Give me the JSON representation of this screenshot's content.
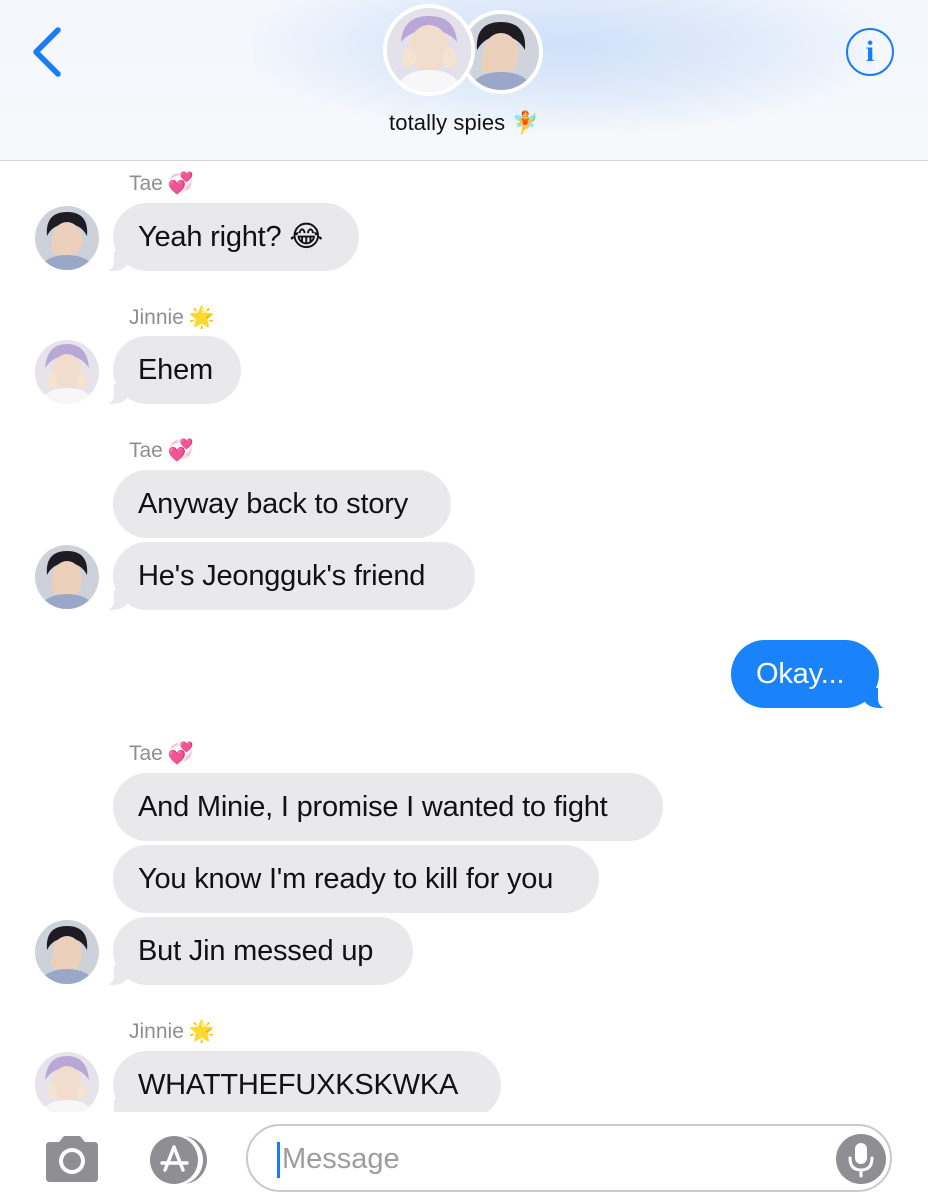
{
  "header": {
    "title": "totally spies",
    "title_emoji": "🧚"
  },
  "messages": [
    {
      "sender": "Tae",
      "emoji": "💞",
      "texts": [
        "Yeah right? 😂"
      ]
    },
    {
      "sender": "Jinnie",
      "emoji": "🌟",
      "texts": [
        "Ehem"
      ]
    },
    {
      "sender": "Tae",
      "emoji": "💞",
      "texts": [
        "Anyway back to story",
        "He's Jeongguk's friend"
      ]
    },
    {
      "outgoing": true,
      "texts": [
        "Okay..."
      ]
    },
    {
      "sender": "Tae",
      "emoji": "💞",
      "texts": [
        "And Minie, I promise I wanted to fight",
        "You know I'm ready to kill for you",
        "But Jin messed up"
      ]
    },
    {
      "sender": "Jinnie",
      "emoji": "🌟",
      "texts": [
        "WHATTHEFUXKSKWKA"
      ]
    }
  ],
  "compose": {
    "placeholder": "Message"
  },
  "colors": {
    "accent": "#1a7cf5",
    "outgoing_bubble": "#1a82fa",
    "incoming_bubble": "#e9e9eb"
  },
  "icons": [
    "back-chevron-icon",
    "info-icon",
    "camera-icon",
    "app-store-icon",
    "microphone-icon"
  ]
}
